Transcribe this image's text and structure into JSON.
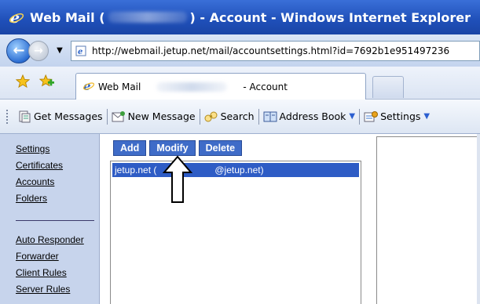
{
  "window": {
    "title_prefix": "Web Mail (",
    "title_suffix": ") - Account - Windows Internet Explorer"
  },
  "address_bar": {
    "url": "http://webmail.jetup.net/mail/accountsettings.html?id=7692b1e951497236"
  },
  "tabs": {
    "active_label": "Web Mail",
    "active_suffix": "- Account"
  },
  "toolbar": {
    "items": [
      {
        "label": "Get Messages",
        "icon": "get-messages-icon"
      },
      {
        "label": "New Message",
        "icon": "new-message-icon"
      },
      {
        "label": "Search",
        "icon": "search-icon"
      },
      {
        "label": "Address Book",
        "icon": "address-book-icon"
      },
      {
        "label": "Settings",
        "icon": "settings-icon"
      }
    ]
  },
  "sidebar": {
    "top_links": [
      "Settings",
      "Certificates",
      "Accounts",
      "Folders"
    ],
    "bottom_links": [
      "Auto Responder",
      "Forwarder",
      "Client Rules",
      "Server Rules"
    ]
  },
  "account_buttons": {
    "add": "Add",
    "modify": "Modify",
    "delete": "Delete"
  },
  "accounts": [
    {
      "left": "jetup.net (",
      "right": "@jetup.net)"
    }
  ],
  "colors": {
    "titlebar": "#1f4fb8",
    "sidebar_bg": "#c7d4ec",
    "button_bg": "#3f6cc8",
    "selected_row": "#2e5cc5"
  }
}
